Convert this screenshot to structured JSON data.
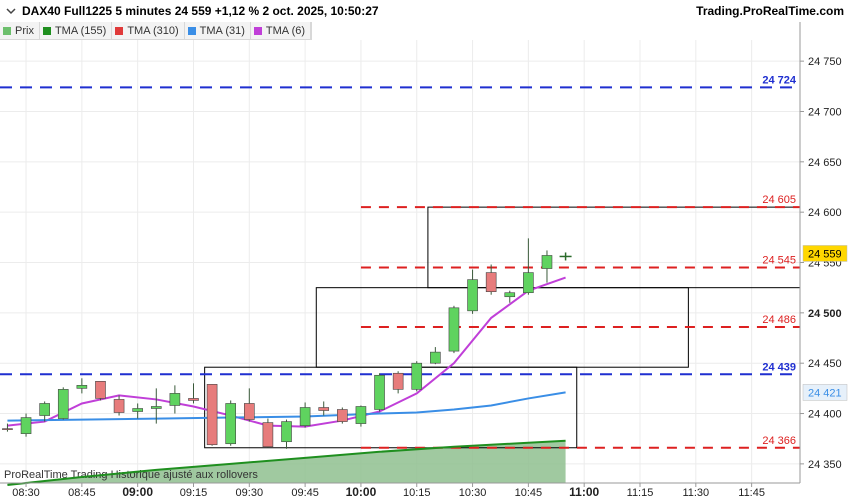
{
  "header": {
    "title": "DAX40 Full1225 5 minutes 24 559 +1,12 % 2 oct. 2025, 10:50:27",
    "site": "Trading.ProRealTime.com"
  },
  "legend": [
    {
      "label": "Prix",
      "color": "#6cbf6c"
    },
    {
      "label": "TMA (155)",
      "color": "#1f8f1f"
    },
    {
      "label": "TMA (310)",
      "color": "#e03a3a"
    },
    {
      "label": "TMA (31)",
      "color": "#3a8ee6"
    },
    {
      "label": "TMA (6)",
      "color": "#c03fd8"
    }
  ],
  "footer_note": "ProRealTime Trading  Historique ajusté aux rollovers",
  "chart_data": {
    "type": "candlestick",
    "x_tick_labels": [
      "08:30",
      "08:45",
      "09:00",
      "09:15",
      "09:30",
      "09:45",
      "10:00",
      "10:15",
      "10:30",
      "10:45",
      "11:00",
      "11:15",
      "11:30",
      "11:45"
    ],
    "bold_x_ticks": [
      "09:00",
      "10:00",
      "11:00"
    ],
    "y_tick_labels": [
      "24 750",
      "24 700",
      "24 650",
      "24 600",
      "24 550",
      "24 500",
      "24 450",
      "24 400",
      "24 350"
    ],
    "y_ticks": [
      24750,
      24700,
      24650,
      24600,
      24550,
      24500,
      24450,
      24400,
      24350
    ],
    "ylim": [
      24331,
      24771
    ],
    "x_range": [
      "08:23",
      "11:58"
    ],
    "candles": [
      {
        "t": "08:25",
        "o": 24385,
        "h": 24390,
        "l": 24382,
        "c": 24384
      },
      {
        "t": "08:30",
        "o": 24380,
        "h": 24400,
        "l": 24377,
        "c": 24396
      },
      {
        "t": "08:35",
        "o": 24398,
        "h": 24412,
        "l": 24392,
        "c": 24410
      },
      {
        "t": "08:40",
        "o": 24395,
        "h": 24426,
        "l": 24394,
        "c": 24424
      },
      {
        "t": "08:45",
        "o": 24425,
        "h": 24435,
        "l": 24420,
        "c": 24428
      },
      {
        "t": "08:50",
        "o": 24432,
        "h": 24432,
        "l": 24413,
        "c": 24415
      },
      {
        "t": "08:55",
        "o": 24414,
        "h": 24418,
        "l": 24398,
        "c": 24401
      },
      {
        "t": "09:00",
        "o": 24402,
        "h": 24410,
        "l": 24395,
        "c": 24405
      },
      {
        "t": "09:05",
        "o": 24405,
        "h": 24425,
        "l": 24390,
        "c": 24407
      },
      {
        "t": "09:10",
        "o": 24408,
        "h": 24428,
        "l": 24400,
        "c": 24420
      },
      {
        "t": "09:15",
        "o": 24415,
        "h": 24430,
        "l": 24410,
        "c": 24413
      },
      {
        "t": "09:20",
        "o": 24429,
        "h": 24429,
        "l": 24368,
        "c": 24369
      },
      {
        "t": "09:25",
        "o": 24370,
        "h": 24413,
        "l": 24368,
        "c": 24410
      },
      {
        "t": "09:30",
        "o": 24410,
        "h": 24425,
        "l": 24392,
        "c": 24394
      },
      {
        "t": "09:35",
        "o": 24391,
        "h": 24395,
        "l": 24366,
        "c": 24367
      },
      {
        "t": "09:40",
        "o": 24372,
        "h": 24394,
        "l": 24365,
        "c": 24392
      },
      {
        "t": "09:45",
        "o": 24388,
        "h": 24411,
        "l": 24386,
        "c": 24406
      },
      {
        "t": "09:50",
        "o": 24406,
        "h": 24412,
        "l": 24398,
        "c": 24403
      },
      {
        "t": "09:55",
        "o": 24404,
        "h": 24406,
        "l": 24390,
        "c": 24392
      },
      {
        "t": "10:00",
        "o": 24390,
        "h": 24408,
        "l": 24387,
        "c": 24407
      },
      {
        "t": "10:05",
        "o": 24404,
        "h": 24440,
        "l": 24402,
        "c": 24438
      },
      {
        "t": "10:10",
        "o": 24440,
        "h": 24442,
        "l": 24420,
        "c": 24424
      },
      {
        "t": "10:15",
        "o": 24424,
        "h": 24452,
        "l": 24422,
        "c": 24450
      },
      {
        "t": "10:20",
        "o": 24450,
        "h": 24466,
        "l": 24449,
        "c": 24461
      },
      {
        "t": "10:25",
        "o": 24462,
        "h": 24507,
        "l": 24460,
        "c": 24505
      },
      {
        "t": "10:30",
        "o": 24502,
        "h": 24543,
        "l": 24499,
        "c": 24533
      },
      {
        "t": "10:35",
        "o": 24540,
        "h": 24548,
        "l": 24518,
        "c": 24521
      },
      {
        "t": "10:40",
        "o": 24516,
        "h": 24522,
        "l": 24510,
        "c": 24520
      },
      {
        "t": "10:45",
        "o": 24520,
        "h": 24574,
        "l": 24518,
        "c": 24540
      },
      {
        "t": "10:50",
        "o": 24544,
        "h": 24562,
        "l": 24530,
        "c": 24557
      }
    ],
    "series": [
      {
        "name": "TMA (6)",
        "color": "#c03fd8",
        "points": [
          [
            "08:25",
            24388
          ],
          [
            "08:35",
            24392
          ],
          [
            "08:45",
            24410
          ],
          [
            "08:55",
            24418
          ],
          [
            "09:05",
            24414
          ],
          [
            "09:15",
            24407
          ],
          [
            "09:25",
            24398
          ],
          [
            "09:35",
            24388
          ],
          [
            "09:45",
            24387
          ],
          [
            "09:55",
            24393
          ],
          [
            "10:05",
            24402
          ],
          [
            "10:15",
            24420
          ],
          [
            "10:25",
            24450
          ],
          [
            "10:35",
            24495
          ],
          [
            "10:45",
            24522
          ],
          [
            "10:55",
            24535
          ]
        ]
      },
      {
        "name": "TMA (31)",
        "color": "#3a8ee6",
        "points": [
          [
            "08:25",
            24393
          ],
          [
            "08:45",
            24394
          ],
          [
            "09:05",
            24395
          ],
          [
            "09:25",
            24396
          ],
          [
            "09:45",
            24397
          ],
          [
            "10:05",
            24400
          ],
          [
            "10:15",
            24401
          ],
          [
            "10:25",
            24404
          ],
          [
            "10:35",
            24408
          ],
          [
            "10:45",
            24415
          ],
          [
            "10:55",
            24421
          ]
        ]
      },
      {
        "name": "TMA (155)",
        "color": "#1f8f1f",
        "points": [
          [
            "08:25",
            24329
          ],
          [
            "08:45",
            24337
          ],
          [
            "09:05",
            24344
          ],
          [
            "09:25",
            24350
          ],
          [
            "09:45",
            24356
          ],
          [
            "10:05",
            24362
          ],
          [
            "10:25",
            24367
          ],
          [
            "10:45",
            24371
          ],
          [
            "10:55",
            24373
          ]
        ]
      }
    ],
    "horizontal_lines": [
      {
        "value": 24724,
        "label": "24 724",
        "color": "#1f2fd0",
        "from": "08:23",
        "dash_long": true
      },
      {
        "value": 24605,
        "label": "24 605",
        "color": "#dd2020",
        "from": "10:00"
      },
      {
        "value": 24545,
        "label": "24 545",
        "color": "#dd2020",
        "from": "10:00"
      },
      {
        "value": 24486,
        "label": "24 486",
        "color": "#dd2020",
        "from": "10:00"
      },
      {
        "value": 24439,
        "label": "24 439",
        "color": "#1f2fd0",
        "from": "08:23",
        "dash_long": true
      },
      {
        "value": 24366,
        "label": "24 366",
        "color": "#dd2020",
        "from": "10:00"
      }
    ],
    "boxes": [
      {
        "t1": "09:18",
        "t2": "10:58",
        "y1": 24366,
        "y2": 24446
      },
      {
        "t1": "09:48",
        "t2": "11:28",
        "y1": 24446,
        "y2": 24525
      },
      {
        "t1": "10:18",
        "t2": "11:58",
        "y1": 24525,
        "y2": 24605
      }
    ],
    "price_badges": [
      {
        "value": 24559,
        "label": "24 559",
        "bg": "#ffd700",
        "fg": "#000000"
      },
      {
        "value": 24421,
        "label": "24 421",
        "bg": "#e6f0fa",
        "fg": "#3a8ee6"
      }
    ],
    "current_price_marker": {
      "t": "10:50",
      "value": 24556
    }
  }
}
